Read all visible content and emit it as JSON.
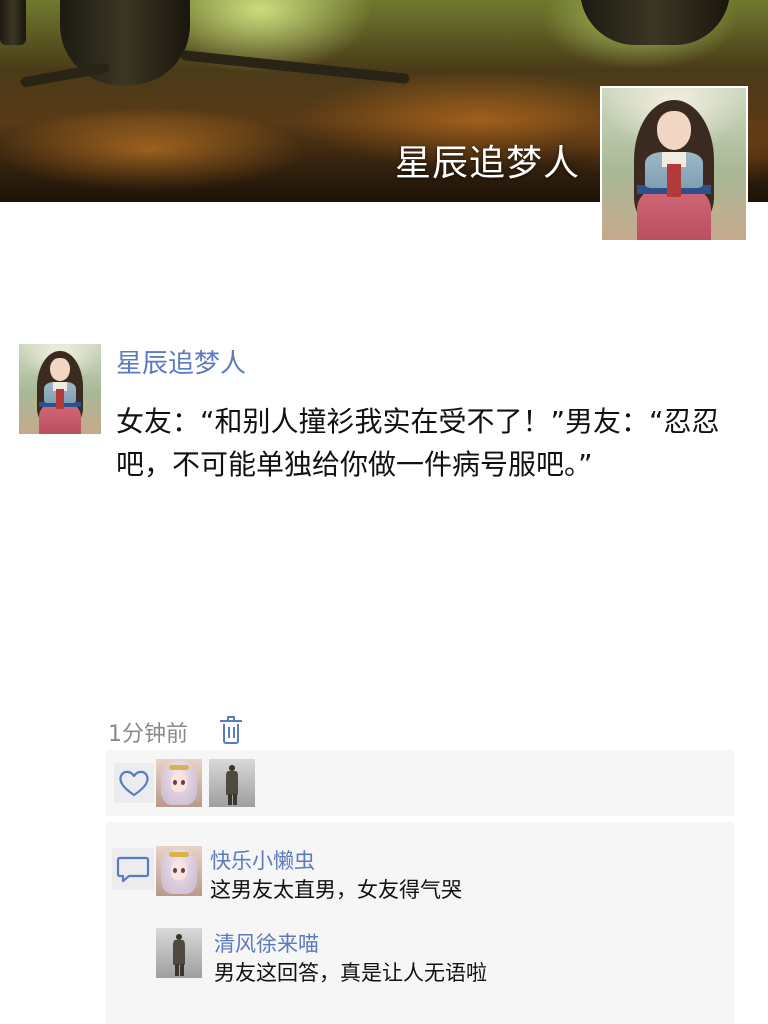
{
  "profile": {
    "cover_name": "星辰追梦人"
  },
  "post": {
    "author": "星辰追梦人",
    "text": "女友：“和别人撞衫我实在受不了！”男友：“忍忍吧，不可能单独给你做一件病号服吧。”",
    "time": "1分钟前"
  },
  "likes": {
    "icon": "heart-icon",
    "users": [
      {
        "avatar": "anime-girl-avatar"
      },
      {
        "avatar": "standing-man-avatar"
      }
    ]
  },
  "comments": {
    "icon": "comment-bubble-icon",
    "items": [
      {
        "name": "快乐小懒虫",
        "text": "这男友太直男，女友得气哭"
      },
      {
        "name": "清风徐来喵",
        "text": "男友这回答，真是让人无语啦"
      }
    ]
  },
  "colors": {
    "link": "#5b7bbf",
    "panel": "#f6f6f7",
    "muted": "#8a8a8a"
  }
}
